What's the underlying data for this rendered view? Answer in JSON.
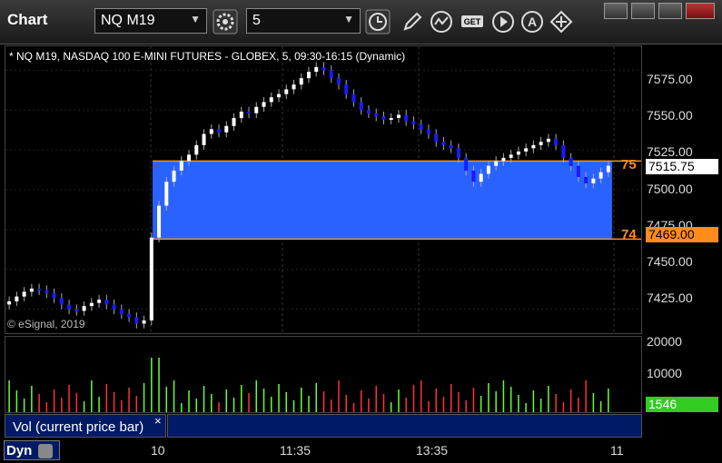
{
  "window": {
    "title": "Chart"
  },
  "toolbar": {
    "symbol": "NQ M19",
    "interval": "5",
    "icons": [
      "gear-icon",
      "clock-icon",
      "pencil-icon",
      "chart-line-icon",
      "get-icon",
      "play-icon",
      "alert-icon",
      "diamond-arrows-icon"
    ]
  },
  "chart": {
    "header": "* NQ M19, NASDAQ 100 E-MINI FUTURES - GLOBEX, 5, 09:30-16:15 (Dynamic)",
    "copyright": "© eSignal, 2019",
    "y_ticks": [
      "7575.00",
      "7550.00",
      "7525.00",
      "7500.00",
      "7475.00",
      "7450.00",
      "7425.00"
    ],
    "alerts": {
      "upper_label": "75",
      "lower_label": "74"
    },
    "last_price": "7515.75",
    "lower_price": "7469.00",
    "colors": {
      "up": "#ffffff",
      "down": "#1a1aff",
      "zone": "#2962ff",
      "line": "#ff8c1a",
      "vol_up": "#66ff33",
      "vol_down": "#ff3333"
    }
  },
  "volume": {
    "y_ticks": [
      "20000",
      "10000",
      "0"
    ],
    "last_value": "1546",
    "caption": "Vol (current price bar)",
    "close": "×"
  },
  "xaxis": {
    "labels": [
      "10",
      "11:35",
      "13:35",
      "11"
    ],
    "mode": "Dyn"
  },
  "chart_data": {
    "type": "candlestick",
    "ylim": [
      7410,
      7590
    ],
    "upper_level": 7518,
    "lower_level": 7469,
    "close_series": [
      7430,
      7433,
      7436,
      7438,
      7437,
      7435,
      7432,
      7428,
      7425,
      7424,
      7427,
      7429,
      7431,
      7428,
      7425,
      7422,
      7420,
      7416,
      7418,
      7470,
      7490,
      7505,
      7512,
      7518,
      7522,
      7528,
      7535,
      7538,
      7536,
      7540,
      7545,
      7549,
      7548,
      7552,
      7555,
      7558,
      7560,
      7563,
      7566,
      7570,
      7574,
      7577,
      7575,
      7570,
      7566,
      7560,
      7555,
      7550,
      7548,
      7546,
      7544,
      7545,
      7547,
      7543,
      7541,
      7538,
      7535,
      7530,
      7528,
      7526,
      7520,
      7512,
      7505,
      7510,
      7515,
      7518,
      7520,
      7522,
      7524,
      7526,
      7528,
      7530,
      7532,
      7528,
      7520,
      7515,
      7508,
      7504,
      7507,
      7511,
      7515
    ]
  }
}
